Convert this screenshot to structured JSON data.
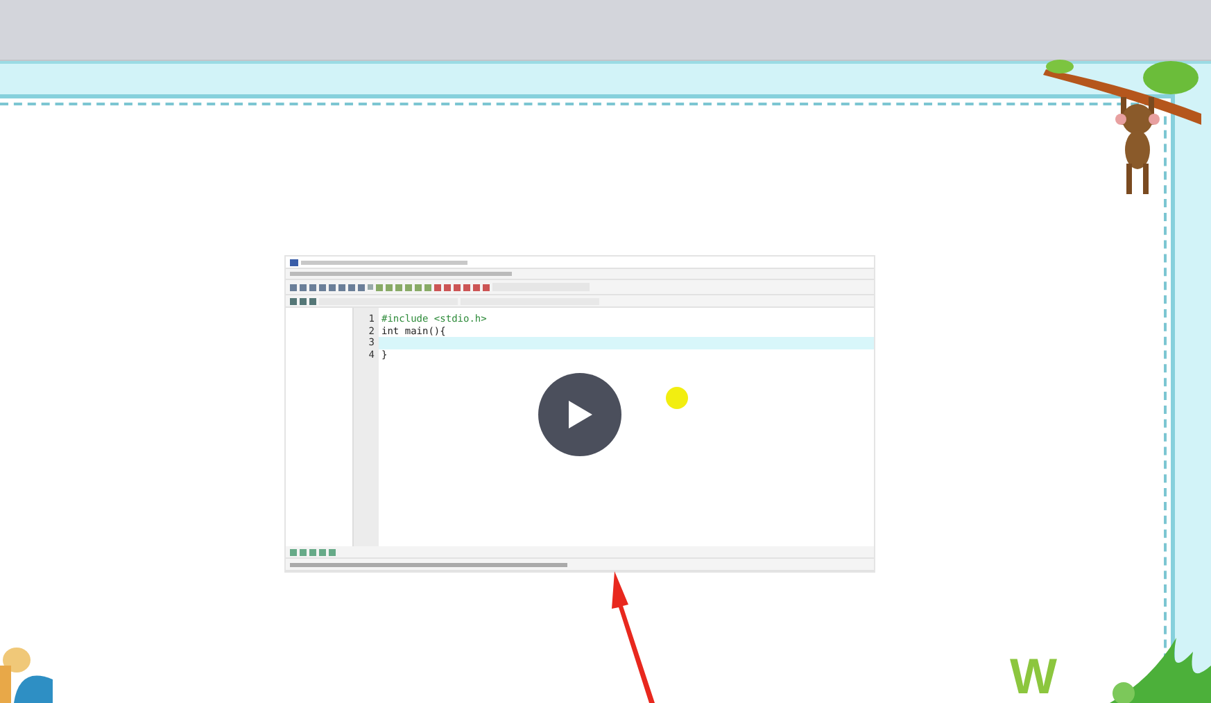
{
  "video": {
    "editor": {
      "lines": [
        {
          "number": "1",
          "code": "#include <stdio.h>",
          "kind": "directive",
          "highlighted": false
        },
        {
          "number": "2",
          "code": "int main(){",
          "kind": "code",
          "highlighted": false
        },
        {
          "number": "3",
          "kind": "code",
          "highlighted": true
        },
        {
          "number": "4",
          "code": "}",
          "kind": "code",
          "highlighted": false
        }
      ]
    }
  },
  "decoration_letter": "W"
}
